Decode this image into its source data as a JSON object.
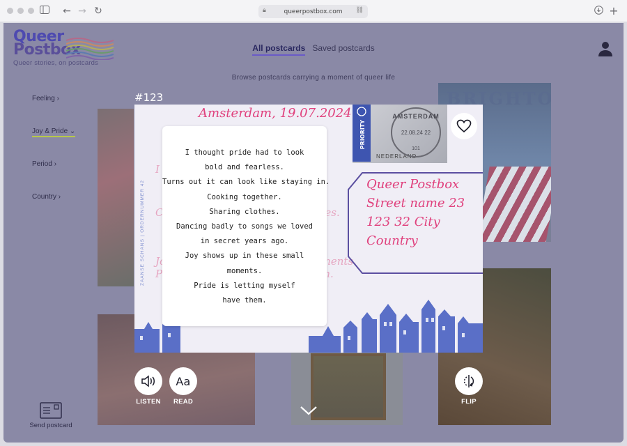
{
  "browser": {
    "url": "queerpostbox.com",
    "icons": [
      "sidebar-icon",
      "back-icon",
      "forward-icon",
      "reload-icon",
      "lock-icon",
      "link-icon",
      "download-icon",
      "new-tab-icon"
    ]
  },
  "header": {
    "logo_line1": "Queer",
    "logo_line2": "Postbox",
    "tagline": "Queer stories, on postcards",
    "tabs": [
      {
        "label": "All postcards",
        "active": true
      },
      {
        "label": "Saved postcards",
        "active": false
      }
    ],
    "accent": "#6a5ac8"
  },
  "subtitle": "Browse postcards carrying a moment of queer life",
  "filters": [
    {
      "label": "Feeling",
      "chevron": "›",
      "active": false
    },
    {
      "label": "Joy & Pride",
      "chevron": "⌄",
      "active": true
    },
    {
      "label": "Period",
      "chevron": "›",
      "active": false
    },
    {
      "label": "Country",
      "chevron": "›",
      "active": false
    }
  ],
  "send_postcard": {
    "label": "Send postcard"
  },
  "background_cards": {
    "brighton_label": "BRIGHTON"
  },
  "card": {
    "number": "#123",
    "handwriting_date": "Amsterdam, 19.07.2024",
    "stamp_country": "NEDERLAND",
    "postmark_city": "AMSTERDAM",
    "postmark_date": "22.08.24 22",
    "stamp_value": "101",
    "stamp_label": "PRIORITY",
    "vertical_text": "ZAANSE SCHANS | ORDERNUMMER 42",
    "address": [
      "Queer Postbox",
      "Street name 23",
      "123 32 City",
      "Country"
    ],
    "message": [
      "I thought pride had to look",
      "bold and fearless.",
      "Turns out it can look like staying in.",
      "Cooking together.",
      "Sharing clothes.",
      "Dancing badly to songs we loved",
      "in secret years ago.",
      "Joy shows up in these small",
      "moments.",
      "Pride is letting myself",
      "have them."
    ],
    "ink_color": "#e0417d",
    "stamp_color": "#3e55b0"
  },
  "controls": {
    "listen": "LISTEN",
    "read": "READ",
    "flip": "FLIP"
  }
}
